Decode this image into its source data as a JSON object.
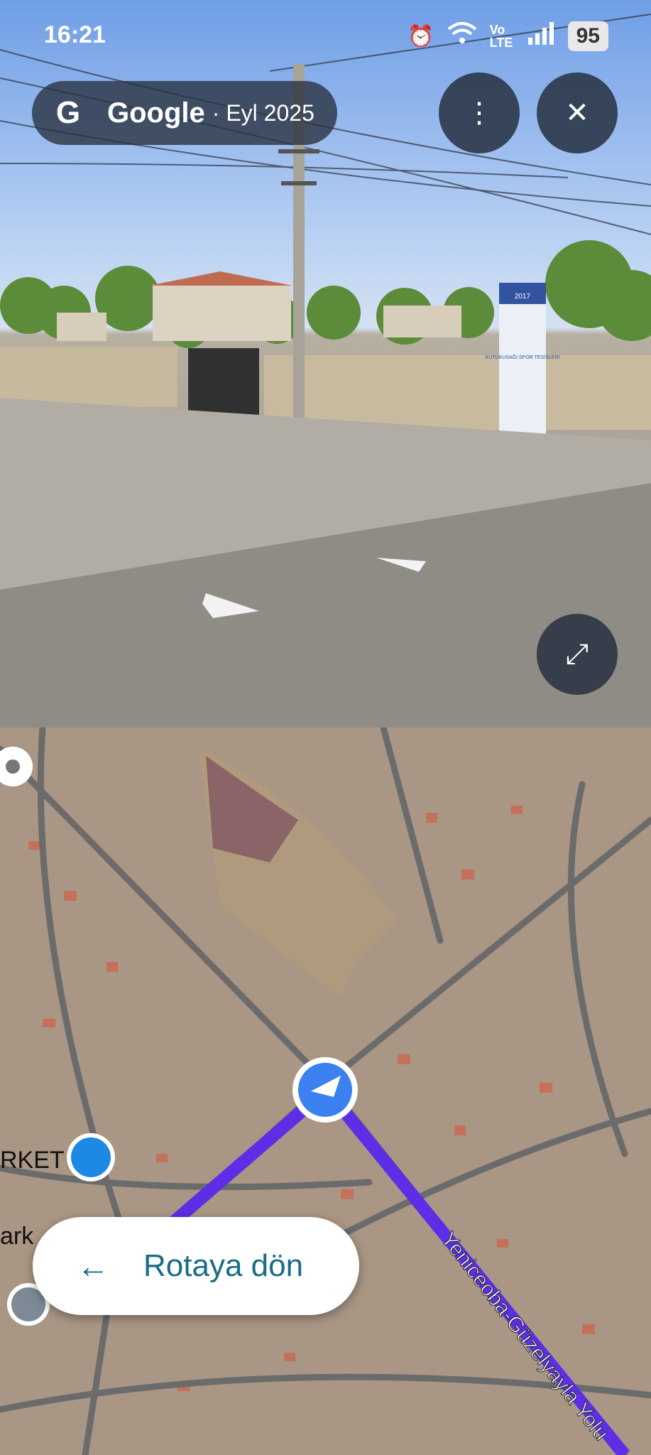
{
  "status": {
    "time": "16:21",
    "battery": "95",
    "network": "Vo LTE"
  },
  "header": {
    "brand": "Google",
    "date": "· Eyl 2025",
    "logo": "G"
  },
  "buttons": {
    "menu_icon": "⋮",
    "close_icon": "✕",
    "expand_icon": "⤢"
  },
  "street_view": {
    "sign_year": "2017",
    "sign_text": "KUTUKUSAĞI SPOR TESİSLERİ"
  },
  "map": {
    "road_label": "Yeniceoba-Güzelyayla Yolu",
    "poi_market": "RKET",
    "poi_park": "ark"
  },
  "route_button": {
    "label": "Rotaya dön",
    "arrow": "←"
  }
}
